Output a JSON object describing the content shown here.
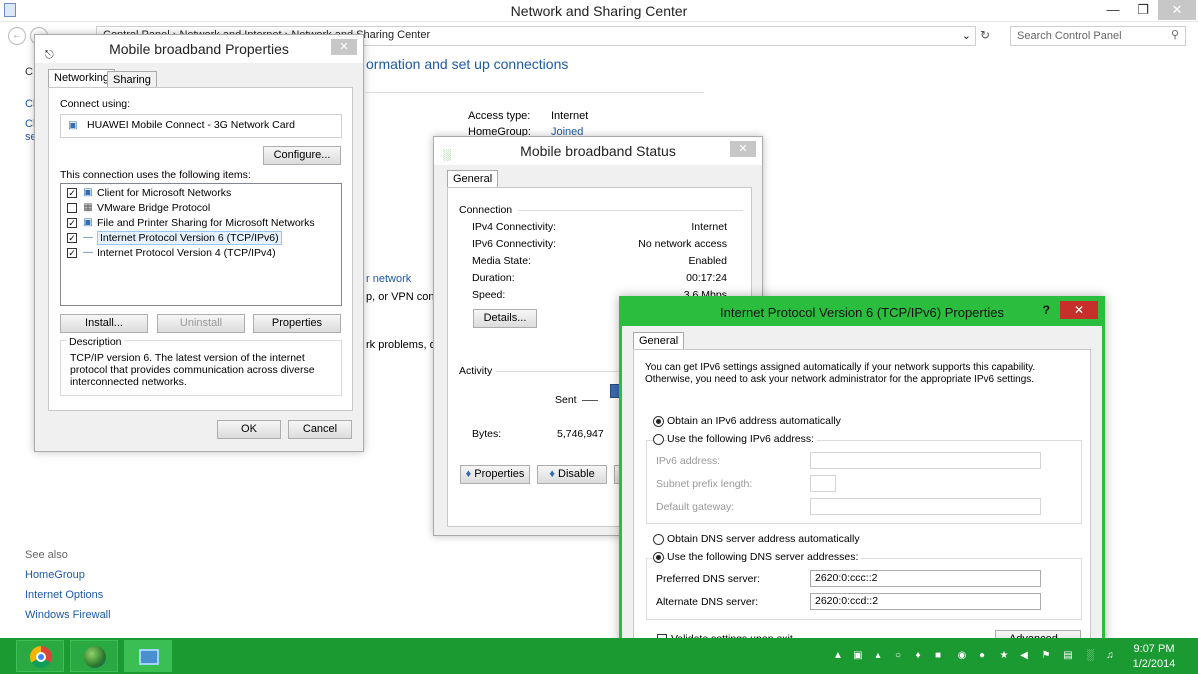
{
  "main_window": {
    "title": "Network and Sharing Center",
    "breadcrumb": [
      "Control Panel",
      "Network and Internet",
      "Network and Sharing Center"
    ],
    "search_placeholder": "Search Control Panel",
    "heading_partial": "ormation and set up connections",
    "access_type_label": "Access type:",
    "access_type_value": "Internet",
    "homegroup_label": "HomeGroup:",
    "homegroup_value": "Joined",
    "frag_network": "r network",
    "frag_vpn": "p, or VPN conn",
    "frag_problems": "rk problems, o",
    "left_frags": [
      "C",
      "Cl",
      "Cl",
      "se"
    ],
    "see_also_title": "See also",
    "see_also": [
      "HomeGroup",
      "Internet Options",
      "Windows Firewall"
    ]
  },
  "props_dialog": {
    "title": "Mobile broadband Properties",
    "tabs": [
      "Networking",
      "Sharing"
    ],
    "connect_using_label": "Connect using:",
    "adapter": "HUAWEI Mobile Connect - 3G Network Card",
    "configure_btn": "Configure...",
    "items_label": "This connection uses the following items:",
    "items": [
      {
        "label": "Client for Microsoft Networks",
        "checked": true
      },
      {
        "label": "VMware Bridge Protocol",
        "checked": false
      },
      {
        "label": "File and Printer Sharing for Microsoft Networks",
        "checked": true
      },
      {
        "label": "Internet Protocol Version 6 (TCP/IPv6)",
        "checked": true
      },
      {
        "label": "Internet Protocol Version 4 (TCP/IPv4)",
        "checked": true
      }
    ],
    "install_btn": "Install...",
    "uninstall_btn": "Uninstall",
    "properties_btn": "Properties",
    "description_label": "Description",
    "description": "TCP/IP version 6. The latest version of the internet protocol that provides communication across diverse interconnected networks.",
    "ok_btn": "OK",
    "cancel_btn": "Cancel"
  },
  "status_dialog": {
    "title": "Mobile broadband Status",
    "tab": "General",
    "connection_label": "Connection",
    "rows": [
      {
        "label": "IPv4 Connectivity:",
        "value": "Internet"
      },
      {
        "label": "IPv6 Connectivity:",
        "value": "No network access"
      },
      {
        "label": "Media State:",
        "value": "Enabled"
      },
      {
        "label": "Duration:",
        "value": "00:17:24"
      },
      {
        "label": "Speed:",
        "value": "3.6 Mbps"
      }
    ],
    "details_btn": "Details...",
    "activity_label": "Activity",
    "sent_label": "Sent",
    "bytes_label": "Bytes:",
    "bytes_sent": "5,746,947",
    "properties_btn": "Properties",
    "disable_btn": "Disable"
  },
  "ipv6_dialog": {
    "title": "Internet Protocol Version 6 (TCP/IPv6) Properties",
    "help": "?",
    "tab": "General",
    "intro": "You can get IPv6 settings assigned automatically if your network supports this capability. Otherwise, you need to ask your network administrator for the appropriate IPv6 settings.",
    "auto_addr": "Obtain an IPv6 address automatically",
    "manual_addr": "Use the following IPv6 address:",
    "ipv6_address_label": "IPv6 address:",
    "subnet_label": "Subnet prefix length:",
    "gateway_label": "Default gateway:",
    "auto_dns": "Obtain DNS server address automatically",
    "manual_dns": "Use the following DNS server addresses:",
    "preferred_dns_label": "Preferred DNS server:",
    "preferred_dns_value": "2620:0:ccc::2",
    "alternate_dns_label": "Alternate DNS server:",
    "alternate_dns_value": "2620:0:ccd::2",
    "validate_label": "Validate settings upon exit",
    "advanced_btn": "Advanced..."
  },
  "taskbar": {
    "time": "9:07 PM",
    "date": "1/2/2014",
    "apps": [
      "chrome-icon",
      "globe-app-icon",
      "network-app-icon"
    ],
    "accent": "#1b9a32"
  }
}
